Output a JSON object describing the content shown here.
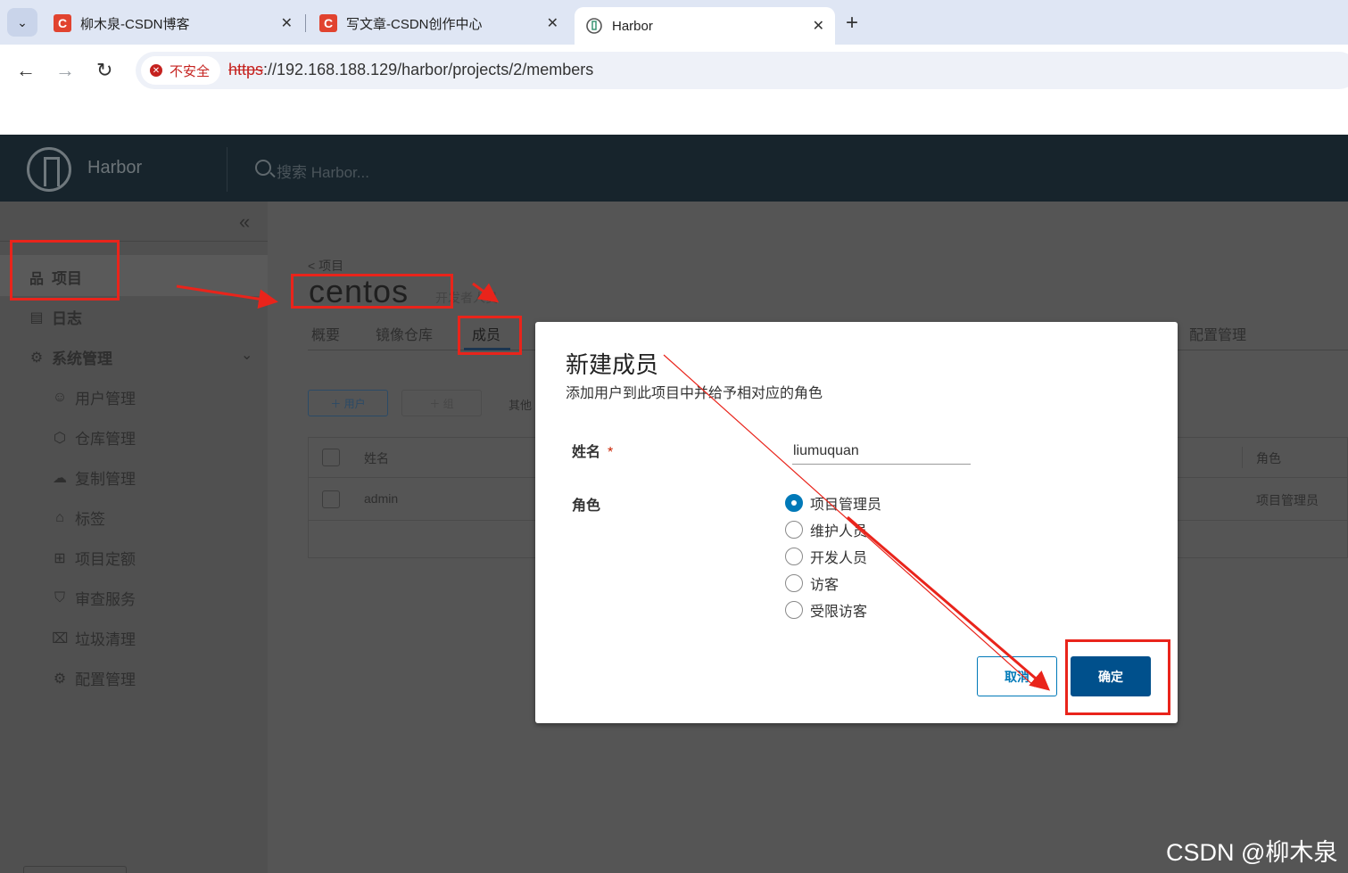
{
  "browser": {
    "tabs": [
      {
        "icon": "C",
        "title": "柳木泉-CSDN博客",
        "close": "✕"
      },
      {
        "icon": "C",
        "title": "写文章-CSDN创作中心",
        "close": "✕"
      },
      {
        "icon": "harbor-favicon",
        "title": "Harbor",
        "close": "✕",
        "active": true
      }
    ],
    "new_tab": "+",
    "menu_glyph": "⌄",
    "back": "←",
    "forward": "→",
    "reload": "↻",
    "security_label": "不安全",
    "url_scheme": "https",
    "url_rest": "://192.168.188.129/harbor/projects/2/members"
  },
  "app": {
    "title": "Harbor",
    "search_placeholder": "搜索 Harbor..."
  },
  "sidebar": {
    "collapse": "«",
    "items": [
      {
        "label": "项目",
        "icon": "projects-icon",
        "glyph": "品",
        "bold": true
      },
      {
        "label": "日志",
        "icon": "logs-icon",
        "glyph": "▤",
        "bold": true
      },
      {
        "label": "系统管理",
        "icon": "admin-icon",
        "glyph": "⚙",
        "bold": true
      }
    ],
    "chevron": "⌄",
    "sub_items": [
      {
        "label": "用户管理",
        "icon": "users-icon",
        "glyph": "☺"
      },
      {
        "label": "仓库管理",
        "icon": "registries-icon",
        "glyph": "⬡"
      },
      {
        "label": "复制管理",
        "icon": "replication-icon",
        "glyph": "☁"
      },
      {
        "label": "标签",
        "icon": "tag-icon",
        "glyph": "⌂"
      },
      {
        "label": "项目定额",
        "icon": "quota-icon",
        "glyph": "⊞"
      },
      {
        "label": "审查服务",
        "icon": "shield-icon",
        "glyph": "⛉"
      },
      {
        "label": "垃圾清理",
        "icon": "trash-icon",
        "glyph": "⌧"
      },
      {
        "label": "配置管理",
        "icon": "gear-icon",
        "glyph": "⚙"
      }
    ]
  },
  "project": {
    "breadcrumb": "< 项目",
    "name": "centos",
    "subtitle": "开发者人员",
    "tabs": [
      "概要",
      "镜像仓库",
      "成员",
      "配置管理"
    ],
    "selected_tab": "成员",
    "add_user_btn": "＋ 用户",
    "add_group_btn": "＋ 组",
    "other_label": "其他",
    "columns": [
      "姓名",
      "角色"
    ],
    "rows": [
      {
        "name": "admin",
        "role": "项目管理员"
      }
    ]
  },
  "modal": {
    "title": "新建成员",
    "subtitle": "添加用户到此项目中并给予相对应的角色",
    "name_label": "姓名",
    "required_mark": "*",
    "name_value": "liumuquan",
    "role_label": "角色",
    "roles": [
      "项目管理员",
      "维护人员",
      "开发人员",
      "访客",
      "受限访客"
    ],
    "selected_role": "项目管理员",
    "cancel": "取消",
    "confirm": "确定"
  },
  "watermark": "CSDN @柳木泉",
  "colors": {
    "annotation_red": "#e9241b",
    "primary_blue": "#0079b8",
    "confirm_blue": "#00508c",
    "header_dark": "#17242c"
  }
}
